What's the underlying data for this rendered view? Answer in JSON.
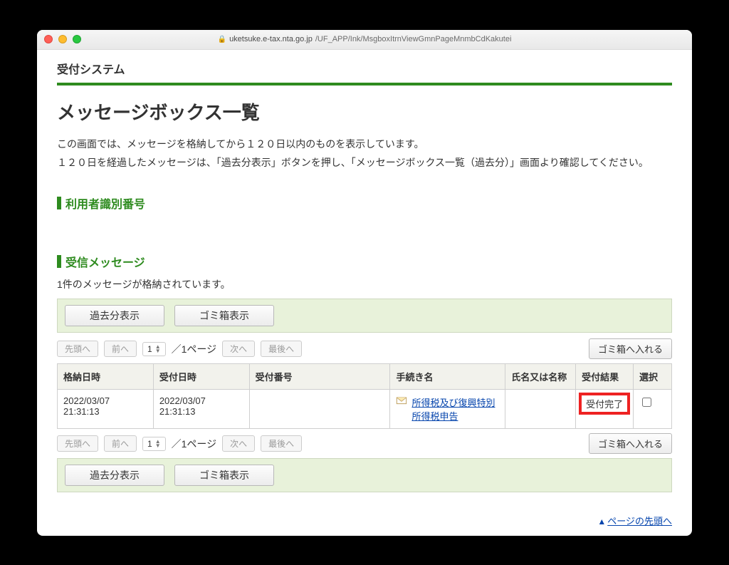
{
  "browser": {
    "url_host": "uketsuke.e-tax.nta.go.jp",
    "url_path": "/UF_APP/Ink/MsgboxItrnViewGmnPageMnmbCdKakutei"
  },
  "app_title": "受付システム",
  "page_title": "メッセージボックス一覧",
  "desc1": "この画面では、メッセージを格納してから１２０日以内のものを表示しています。",
  "desc2": "１２０日を経過したメッセージは、「過去分表示」ボタンを押し、「メッセージボックス一覧（過去分）」画面より確認してください。",
  "section_user_id": "利用者識別番号",
  "section_inbox": "受信メッセージ",
  "inbox_status": "1件のメッセージが格納されています。",
  "toolbar_buttons": {
    "past": "過去分表示",
    "trash": "ゴミ箱表示"
  },
  "pager": {
    "first": "先頭へ",
    "prev": "前へ",
    "next": "次へ",
    "last": "最後へ",
    "page_current": "1",
    "page_total": "／1ページ",
    "to_trash": "ゴミ箱へ入れる"
  },
  "table": {
    "headers": {
      "stored": "格納日時",
      "accepted": "受付日時",
      "number": "受付番号",
      "procedure": "手続き名",
      "name": "氏名又は名称",
      "result": "受付結果",
      "select": "選択"
    },
    "rows": [
      {
        "stored": "2022/03/07 21:31:13",
        "accepted": "2022/03/07 21:31:13",
        "number": "",
        "procedure": "所得税及び復興特別所得税申告",
        "name": "",
        "result": "受付完了"
      }
    ]
  },
  "footer_link": "ページの先頭へ"
}
